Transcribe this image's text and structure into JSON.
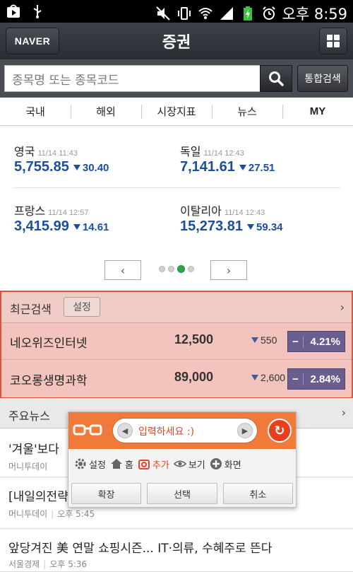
{
  "status_bar": {
    "time": "오후 8:59",
    "icons": [
      "play-store-icon",
      "usb-icon",
      "mute-icon",
      "vibrate-icon",
      "wifi-icon",
      "signal-icon",
      "battery-charging-icon",
      "alarm-icon"
    ]
  },
  "header": {
    "logo": "NAVER",
    "title": "증권"
  },
  "search": {
    "placeholder": "종목명 또는 종목코드",
    "total_button": "통합검색"
  },
  "tabs": [
    "국내",
    "해외",
    "시장지표",
    "뉴스",
    "MY"
  ],
  "indices": [
    {
      "name": "영국",
      "time": "11/14 11:43",
      "value": "5,755.85",
      "change": "30.40",
      "direction": "down"
    },
    {
      "name": "독일",
      "time": "11/14 12:43",
      "value": "7,141.61",
      "change": "27.51",
      "direction": "down"
    },
    {
      "name": "프랑스",
      "time": "11/14 12:57",
      "value": "3,415.99",
      "change": "14.61",
      "direction": "down"
    },
    {
      "name": "이탈리아",
      "time": "11/14 12:43",
      "value": "15,273.81",
      "change": "59.34",
      "direction": "down"
    }
  ],
  "pager": {
    "prev": "‹",
    "next": "›",
    "pages": 4,
    "current": 3
  },
  "recent": {
    "title": "최근검색",
    "settings_label": "설정",
    "rows": [
      {
        "name": "네오위즈인터넷",
        "price": "12,500",
        "change": "550",
        "sign": "−",
        "percent": "4.21%"
      },
      {
        "name": "코오롱생명과학",
        "price": "89,000",
        "change": "2,600",
        "sign": "−",
        "percent": "2.84%"
      }
    ]
  },
  "news": {
    "title": "주요뉴스",
    "items": [
      {
        "title": "'겨울'보다",
        "source": "머니투데이",
        "time": ""
      },
      {
        "title": "[내일의전략",
        "source": "머니투데이",
        "time": "오후 5:45"
      },
      {
        "title": "앞당겨진 美 연말 쇼핑시즌... IT·의류, 수혜주로 뜬다",
        "source": "서울경제",
        "time": "오후 5:36"
      }
    ]
  },
  "widget": {
    "input_placeholder": "입력하세요 :)",
    "tools": [
      {
        "icon": "gear-icon",
        "label": "설정"
      },
      {
        "icon": "home-icon",
        "label": "홈"
      },
      {
        "icon": "add-camera-icon",
        "label": "추가"
      },
      {
        "icon": "eye-icon",
        "label": "보기"
      },
      {
        "icon": "plus-circle-icon",
        "label": "화면"
      }
    ],
    "buttons": [
      "확장",
      "선택",
      "취소"
    ],
    "accent": "#f07a3a"
  },
  "colors": {
    "index_blue": "#1b4e9e",
    "highlight_border": "#d9533f",
    "badge": "#6a5d8f",
    "active_dot": "#2ca44c"
  }
}
